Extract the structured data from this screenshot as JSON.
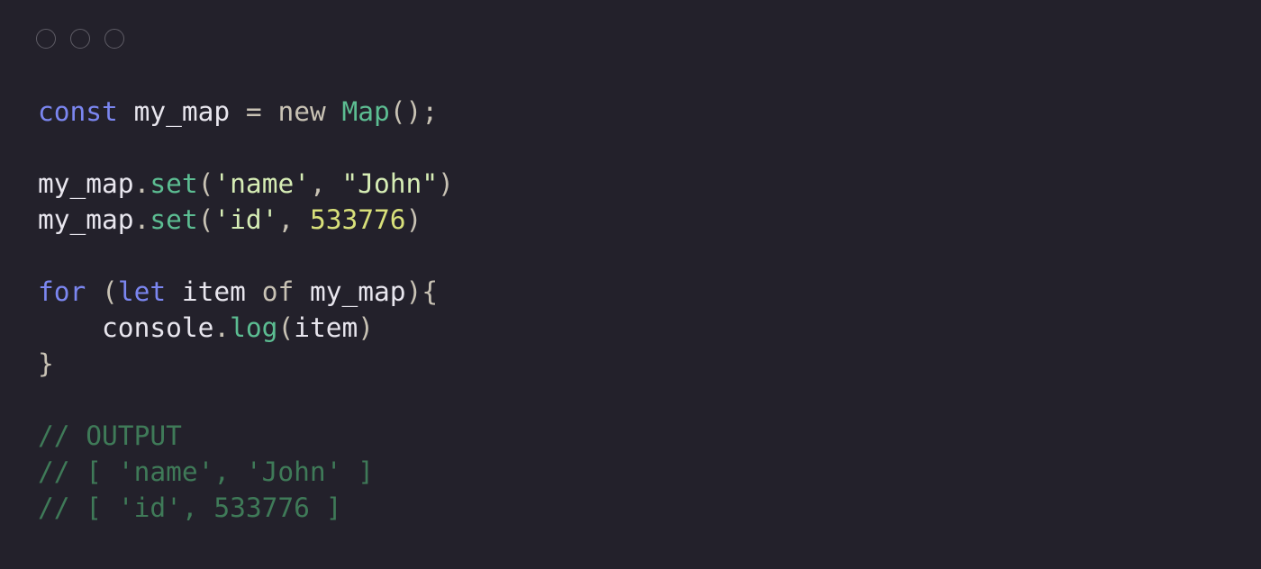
{
  "window_controls": [
    {
      "name": "close"
    },
    {
      "name": "minimize"
    },
    {
      "name": "maximize"
    }
  ],
  "colors": {
    "background": "#23212b",
    "keyword": "#7b86f0",
    "plain": "#e8e6ee",
    "operator": "#c8c2b4",
    "class": "#5cbd92",
    "method": "#5cbd92",
    "string": "#d6edb5",
    "number": "#d8e07a",
    "comment": "#3f7a58",
    "control_outline": "#5f5d66"
  },
  "code": {
    "lines": [
      [
        {
          "text": "const",
          "type": "keyword"
        },
        {
          "text": " my_map ",
          "type": "plain"
        },
        {
          "text": "=",
          "type": "operator"
        },
        {
          "text": " ",
          "type": "plain"
        },
        {
          "text": "new",
          "type": "operator"
        },
        {
          "text": " ",
          "type": "plain"
        },
        {
          "text": "Map",
          "type": "class"
        },
        {
          "text": "();",
          "type": "operator"
        }
      ],
      [],
      [
        {
          "text": "my_map",
          "type": "plain"
        },
        {
          "text": ".",
          "type": "operator"
        },
        {
          "text": "set",
          "type": "method"
        },
        {
          "text": "(",
          "type": "operator"
        },
        {
          "text": "'name'",
          "type": "string"
        },
        {
          "text": ", ",
          "type": "operator"
        },
        {
          "text": "\"John\"",
          "type": "string"
        },
        {
          "text": ")",
          "type": "operator"
        }
      ],
      [
        {
          "text": "my_map",
          "type": "plain"
        },
        {
          "text": ".",
          "type": "operator"
        },
        {
          "text": "set",
          "type": "method"
        },
        {
          "text": "(",
          "type": "operator"
        },
        {
          "text": "'id'",
          "type": "string"
        },
        {
          "text": ", ",
          "type": "operator"
        },
        {
          "text": "533776",
          "type": "number"
        },
        {
          "text": ")",
          "type": "operator"
        }
      ],
      [],
      [
        {
          "text": "for",
          "type": "keyword"
        },
        {
          "text": " (",
          "type": "operator"
        },
        {
          "text": "let",
          "type": "keyword"
        },
        {
          "text": " item ",
          "type": "plain"
        },
        {
          "text": "of",
          "type": "operator"
        },
        {
          "text": " my_map",
          "type": "plain"
        },
        {
          "text": "){",
          "type": "operator"
        }
      ],
      [
        {
          "text": "    console",
          "type": "plain"
        },
        {
          "text": ".",
          "type": "operator"
        },
        {
          "text": "log",
          "type": "method"
        },
        {
          "text": "(",
          "type": "operator"
        },
        {
          "text": "item",
          "type": "plain"
        },
        {
          "text": ")",
          "type": "operator"
        }
      ],
      [
        {
          "text": "}",
          "type": "operator"
        }
      ],
      [],
      [
        {
          "text": "// OUTPUT",
          "type": "comment"
        }
      ],
      [
        {
          "text": "// [ 'name', 'John' ]",
          "type": "comment"
        }
      ],
      [
        {
          "text": "// [ 'id', 533776 ]",
          "type": "comment"
        }
      ]
    ]
  }
}
